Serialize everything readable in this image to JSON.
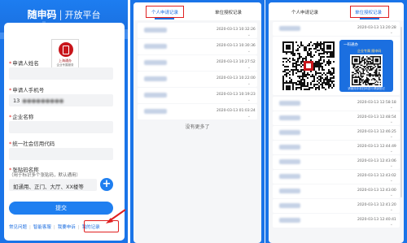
{
  "form_screen": {
    "app_name": "随申码",
    "separator": "|",
    "platform": "开放平台",
    "logo_line1": "上海通办",
    "logo_line2": "企业专属服务",
    "fields": {
      "applicant_name_label": "申请人姓名",
      "applicant_phone_label": "申请人手机号",
      "applicant_phone_value": "13",
      "company_name_label": "企业名称",
      "credit_code_label": "统一社会信用代码",
      "sticker_name_label": "张贴码名称",
      "sticker_name_hint": "（用于标识多个张贴码，默认通用）",
      "sticker_name_placeholder": "如通用、正门、大厅、XX楼等"
    },
    "add_button": "+",
    "submit_button": "提交",
    "links": [
      "常见问题",
      "智能客服",
      "我要申诉",
      "我的记录"
    ]
  },
  "records_screen": {
    "tabs": [
      "个人申请记录",
      "单位授权记录"
    ],
    "active_tab_index": 0,
    "rows": [
      {
        "time": "2020-03-13 10:32:26"
      },
      {
        "time": "2020-03-13 10:30:36"
      },
      {
        "time": "2020-03-13 10:27:52"
      },
      {
        "time": "2020-03-13 10:22:00"
      },
      {
        "time": "2020-03-13 10:19:23"
      },
      {
        "time": "2020-03-13 01:03:24"
      }
    ],
    "no_more_text": "没有更多了"
  },
  "qr_screen": {
    "tabs": [
      "个人申请记录",
      "单位授权记录"
    ],
    "active_tab_index": 1,
    "qr_card": {
      "header": "一码通办",
      "subheader": "企业专属 随申码",
      "footer": "请使用手机扫码进行健康登记"
    },
    "rows_top": [
      {
        "time": "2020-03-13 13:20:28"
      }
    ],
    "rows_bottom": [
      {
        "time": "2020-03-13 12:58:18"
      },
      {
        "time": "2020-03-13 12:48:54"
      },
      {
        "time": "2020-03-13 12:46:25"
      },
      {
        "time": "2020-03-13 12:44:49"
      },
      {
        "time": "2020-03-13 12:43:06"
      },
      {
        "time": "2020-03-13 12:43:02"
      },
      {
        "time": "2020-03-13 12:43:00"
      },
      {
        "time": "2020-03-13 12:41:20"
      },
      {
        "time": "2020-03-13 12:40:41"
      }
    ]
  },
  "colors": {
    "brand_blue": "#1a74e8",
    "accent_blue": "#1f7ff0",
    "annotation_red": "#e02020",
    "logo_red": "#c8151b"
  }
}
